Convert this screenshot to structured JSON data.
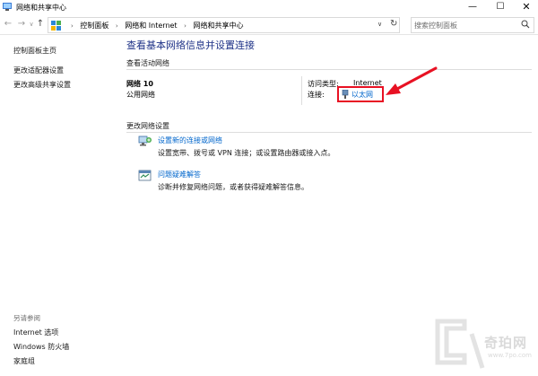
{
  "window": {
    "title": "网络和共享中心",
    "controls": {
      "minimize": "—",
      "maximize": "☐",
      "close": "✕"
    }
  },
  "nav": {
    "back": "←",
    "forward": "→",
    "history": "∨",
    "up": "↑",
    "breadcrumbs": [
      "控制面板",
      "网络和 Internet",
      "网络和共享中心"
    ],
    "separator": "›",
    "dropdown": "∨",
    "refresh": "↻",
    "search_placeholder": "搜索控制面板",
    "search_icon": "search-icon"
  },
  "sidebar": {
    "links": [
      "控制面板主页",
      "更改适配器设置",
      "更改高级共享设置"
    ],
    "see_also_label": "另请参阅",
    "see_also": [
      "Internet 选项",
      "Windows 防火墙",
      "家庭组"
    ]
  },
  "main": {
    "title": "查看基本网络信息并设置连接",
    "active_networks_label": "查看活动网络",
    "network": {
      "name": "网络  10",
      "type": "公用网络",
      "access_type_label": "访问类型:",
      "access_type_value": "Internet",
      "connections_label": "连接:",
      "connection_value": "以太网"
    },
    "change_settings_label": "更改网络设置",
    "tasks": [
      {
        "link": "设置新的连接或网络",
        "desc": "设置宽带、拨号或 VPN 连接；或设置路由器或接入点。",
        "icon": "new-connection-icon"
      },
      {
        "link": "问题疑难解答",
        "desc": "诊断并修复网络问题，或者获得疑难解答信息。",
        "icon": "troubleshoot-icon"
      }
    ]
  },
  "watermark": {
    "text": "奇珀网",
    "url": "www.7po.com"
  },
  "colors": {
    "title_blue": "#1e3287",
    "link_blue": "#0066cc",
    "highlight_red": "#e81123"
  }
}
